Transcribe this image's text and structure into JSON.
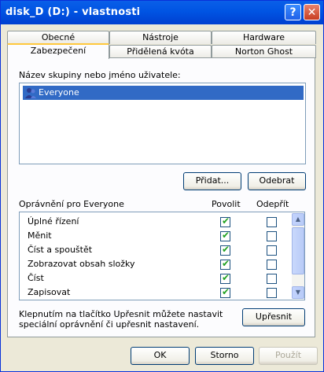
{
  "window": {
    "title": "disk_D (D:) - vlastnosti"
  },
  "titlebar": {
    "help_glyph": "?",
    "close_glyph": "✕"
  },
  "tabs": [
    {
      "label": "Obecné"
    },
    {
      "label": "Nástroje"
    },
    {
      "label": "Hardware"
    },
    {
      "label": "Zabezpečení"
    },
    {
      "label": "Přidělená kvóta"
    },
    {
      "label": "Norton Ghost"
    }
  ],
  "security": {
    "group_label": "Název skupiny nebo jméno uživatele:",
    "users": [
      {
        "name": "Everyone",
        "icon": "user-group-icon"
      }
    ],
    "add_label": "Přidat...",
    "remove_label": "Odebrat",
    "perm_header": "Oprávnění pro Everyone",
    "allow_header": "Povolit",
    "deny_header": "Odepřít",
    "permissions": [
      {
        "name": "Úplné řízení",
        "allow": true,
        "deny": false
      },
      {
        "name": "Měnit",
        "allow": true,
        "deny": false
      },
      {
        "name": "Číst a spouštět",
        "allow": true,
        "deny": false
      },
      {
        "name": "Zobrazovat obsah složky",
        "allow": true,
        "deny": false
      },
      {
        "name": "Číst",
        "allow": true,
        "deny": false
      },
      {
        "name": "Zapisovat",
        "allow": true,
        "deny": false
      }
    ],
    "advanced_text_1": "Klepnutím na tlačítko Upřesnit můžete nastavit",
    "advanced_text_2": "speciální oprávnění či upřesnit nastavení.",
    "advanced_label": "Upřesnit"
  },
  "footer": {
    "ok_label": "OK",
    "cancel_label": "Storno",
    "apply_label": "Použít"
  },
  "colors": {
    "selection": "#316ac5",
    "titlebar": "#0054e3",
    "check": "#21a121"
  }
}
